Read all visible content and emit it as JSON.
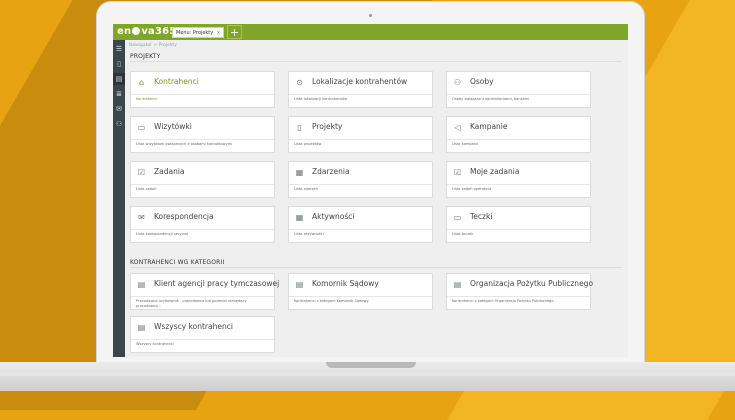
{
  "app": {
    "logo": "en",
    "logo_rest": "va365",
    "tab_label": "Menu: Projekty",
    "tab_close": "x",
    "new_tab": "+"
  },
  "breadcrumb": "Nawigator > Projekty",
  "sidebar": {
    "icons": [
      "menu-icon",
      "folder-icon",
      "document-icon",
      "list-icon",
      "mail-icon",
      "users-icon"
    ]
  },
  "section1": {
    "title": "PROJEKTY",
    "cards": [
      {
        "title": "Kontrahenci",
        "desc": "Kontrahenci",
        "icon": "⌂",
        "icon_name": "building-icon",
        "highlight": true
      },
      {
        "title": "Lokalizacje kontrahentów",
        "desc": "Lista lokalizacji kontrahentów",
        "icon": "⊙",
        "icon_name": "location-icon"
      },
      {
        "title": "Osoby",
        "desc": "Osoby związane z kontrahentami, bankami",
        "icon": "⚇",
        "icon_name": "people-icon"
      },
      {
        "title": "Wizytówki",
        "desc": "Lista wizytówek związanych z osobami kontaktowymi",
        "icon": "▭",
        "icon_name": "card-icon"
      },
      {
        "title": "Projekty",
        "desc": "Lista projektów",
        "icon": "▯",
        "icon_name": "project-icon"
      },
      {
        "title": "Kampanie",
        "desc": "Lista kampanii",
        "icon": "◁",
        "icon_name": "megaphone-icon"
      },
      {
        "title": "Zadania",
        "desc": "Lista zadań",
        "icon": "☑",
        "icon_name": "task-icon"
      },
      {
        "title": "Zdarzenia",
        "desc": "Lista zdarzeń",
        "icon": "▦",
        "icon_name": "event-icon"
      },
      {
        "title": "Moje zadania",
        "desc": "Lista zadań operatora",
        "icon": "☑",
        "icon_name": "my-tasks-icon"
      },
      {
        "title": "Korespondencja",
        "desc": "Lista korespondencji seryjnej",
        "icon": "✉",
        "icon_name": "mail-icon"
      },
      {
        "title": "Aktywności",
        "desc": "Lista aktywności",
        "icon": "▦",
        "icon_name": "calendar-icon"
      },
      {
        "title": "Teczki",
        "desc": "Lista teczek",
        "icon": "▭",
        "icon_name": "folder-icon"
      }
    ]
  },
  "section2": {
    "title": "KONTRAHENCI WG KATEGORII",
    "cards": [
      {
        "title": "Klient agencji pracy tymczasowej",
        "desc": "Pracodawca użytkownik - pracodawca lub podmiot niebędący pracodawcą...",
        "icon": "▤",
        "icon_name": "document-icon"
      },
      {
        "title": "Komornik Sądowy",
        "desc": "Kontrahenci z kategorii Komornik Sądowy",
        "icon": "▤",
        "icon_name": "document-icon"
      },
      {
        "title": "Organizacja Pożytku Publicznego",
        "desc": "Kontrahenci z kategorii Organizacja Pożytku Publicznego",
        "icon": "▤",
        "icon_name": "document-icon"
      },
      {
        "title": "Wszyscy kontrahenci",
        "desc": "Wszyscy kontrahenci",
        "icon": "▤",
        "icon_name": "document-icon"
      }
    ]
  }
}
